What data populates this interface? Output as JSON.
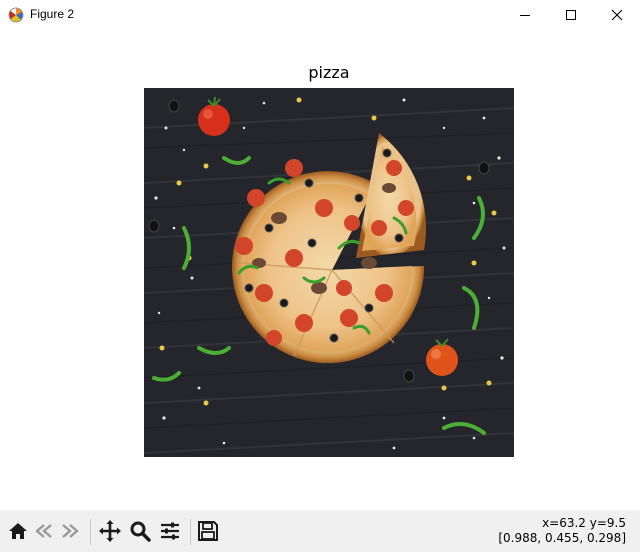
{
  "window": {
    "title": "Figure 2",
    "controls": {
      "minimize": "minimize-icon",
      "maximize": "maximize-icon",
      "close": "close-icon"
    }
  },
  "figure": {
    "axes_title": "pizza",
    "image_subject": "pizza"
  },
  "toolbar": {
    "buttons": [
      "home-icon",
      "back-icon",
      "forward-icon",
      "pan-icon",
      "zoom-icon",
      "configure-subplots-icon",
      "save-icon"
    ]
  },
  "status": {
    "xy": "x=63.2 y=9.5",
    "rgb": "[0.988, 0.455, 0.298]"
  },
  "colors": {
    "toolbar_bg": "#f0f0f0",
    "icon_dark": "#1a1a1a"
  }
}
